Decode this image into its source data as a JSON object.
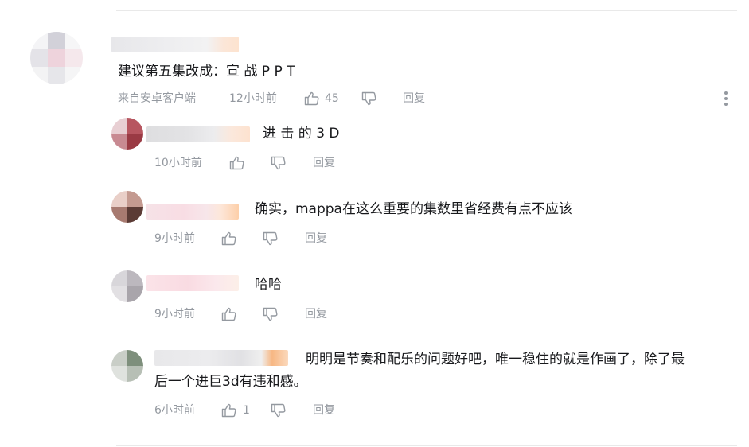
{
  "main_comment": {
    "text": "建议第五集改成：宣 战 P P T",
    "source": "来自安卓客户端",
    "time": "12小时前",
    "likes": "45",
    "reply": "回复"
  },
  "replies": [
    {
      "text": "进 击 的 3 D",
      "time": "10小时前",
      "likes": "",
      "reply": "回复"
    },
    {
      "text": "确实，mappa在这么重要的集数里省经费有点不应该",
      "time": "9小时前",
      "likes": "",
      "reply": "回复"
    },
    {
      "text": "哈哈",
      "time": "9小时前",
      "likes": "",
      "reply": "回复"
    },
    {
      "text_line1": "明明是节奏和配乐的问题好吧，唯一稳住的就是作画了，除了最",
      "text_line2": "后一个进巨3d有违和感。",
      "time": "6小时前",
      "likes": "1",
      "reply": "回复"
    }
  ],
  "icons": {
    "like": "thumbs-up-icon",
    "dislike": "thumbs-down-icon",
    "more": "more-vertical-icon"
  },
  "colors": {
    "text": "#18191c",
    "meta": "#9499a0",
    "divider": "#e9e9e9"
  }
}
